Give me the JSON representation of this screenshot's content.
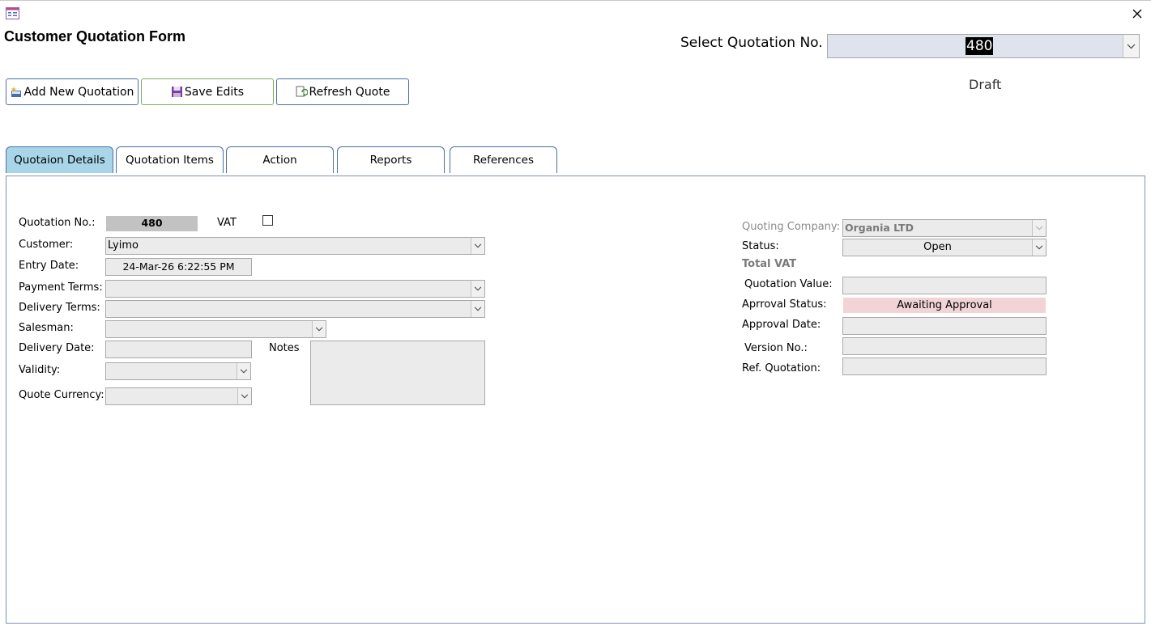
{
  "form": {
    "title": "Customer Quotation Form",
    "select_label": "Select Quotation No.",
    "selected_quotation": "480",
    "document_status": "Draft"
  },
  "toolbar": {
    "add_label": "Add New Quotation",
    "save_label": "Save Edits",
    "refresh_label": "Refresh Quote"
  },
  "tabs": [
    {
      "label": "Quotaion Details",
      "active": true
    },
    {
      "label": "Quotation Items",
      "active": false
    },
    {
      "label": "Action",
      "active": false
    },
    {
      "label": "Reports",
      "active": false
    },
    {
      "label": "References",
      "active": false
    }
  ],
  "details": {
    "quotation_no_label": "Quotation No.:",
    "quotation_no": "480",
    "vat_label": "VAT",
    "vat_checked": false,
    "customer_label": "Customer:",
    "customer": "Lyimo",
    "entry_date_label": "Entry Date:",
    "entry_date": "24-Mar-26 6:22:55 PM",
    "payment_terms_label": "Payment Terms:",
    "payment_terms": "",
    "delivery_terms_label": "Delivery Terms:",
    "delivery_terms": "",
    "salesman_label": "Salesman:",
    "salesman": "",
    "delivery_date_label": "Delivery Date:",
    "delivery_date": "",
    "notes_label": "Notes",
    "notes": "",
    "validity_label": "Validity:",
    "validity": "",
    "quote_currency_label": "Quote Currency:",
    "quote_currency": ""
  },
  "summary": {
    "quoting_company_label": "Quoting Company:",
    "quoting_company": "Organia LTD",
    "status_label": "Status:",
    "status": "Open",
    "total_vat_label": "Total VAT",
    "quotation_value_label": "Quotation Value:",
    "quotation_value": "",
    "approval_status_label": "Aprroval Status:",
    "approval_status": "Awaiting Approval",
    "approval_date_label": "Approval Date:",
    "approval_date": "",
    "version_no_label": "Version No.:",
    "version_no": "",
    "ref_quotation_label": "Ref. Quotation:",
    "ref_quotation": ""
  },
  "colors": {
    "active_tab": "#a8d6e8",
    "approval_status_bg": "#f2d4d7",
    "field_bg": "#ebebeb",
    "combo_highlight_bg": "#dfe3ee"
  }
}
